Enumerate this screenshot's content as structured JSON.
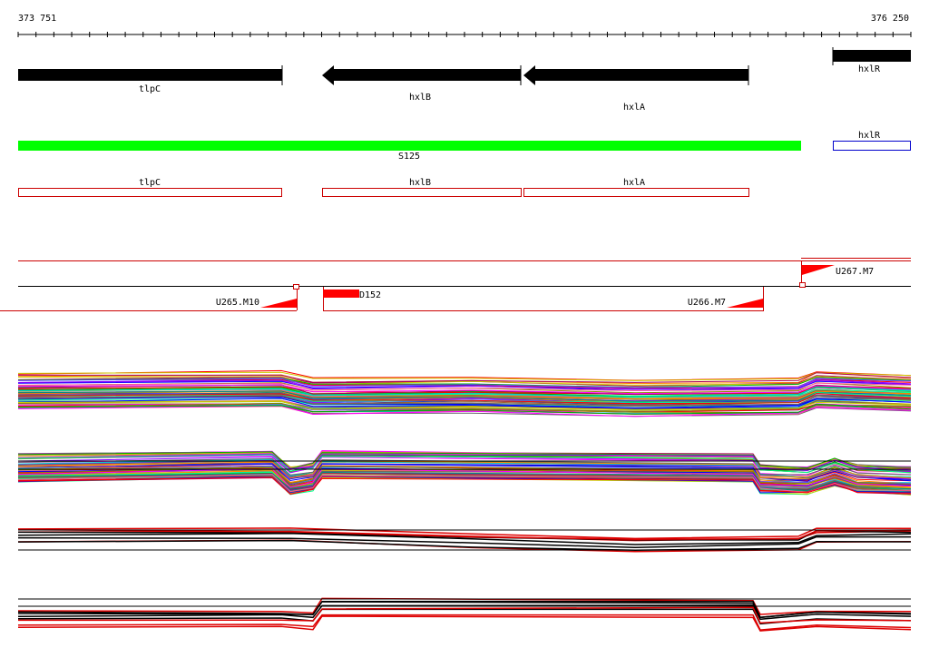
{
  "ruler": {
    "start_label": "373 751",
    "end_label": "376 250"
  },
  "genes": [
    {
      "name": "tlpC",
      "strand": "+"
    },
    {
      "name": "hxlB",
      "strand": "-"
    },
    {
      "name": "hxlA",
      "strand": "-"
    },
    {
      "name": "hxlR",
      "strand": "+"
    }
  ],
  "segment": {
    "label": "S125",
    "color": "#00ff00"
  },
  "partial_box_label": "hxlR",
  "cds_outlines": [
    {
      "label": "tlpC"
    },
    {
      "label": "hxlB"
    },
    {
      "label": "hxlA"
    }
  ],
  "probes": [
    {
      "label": "U265.M10"
    },
    {
      "label": "D152"
    },
    {
      "label": "U266.M7"
    },
    {
      "label": "U267.M7"
    }
  ],
  "colors": {
    "gene_fill": "#000000",
    "outline_red": "#cc0000",
    "outline_blue": "#0000cc",
    "probe_red": "#ff0000"
  }
}
